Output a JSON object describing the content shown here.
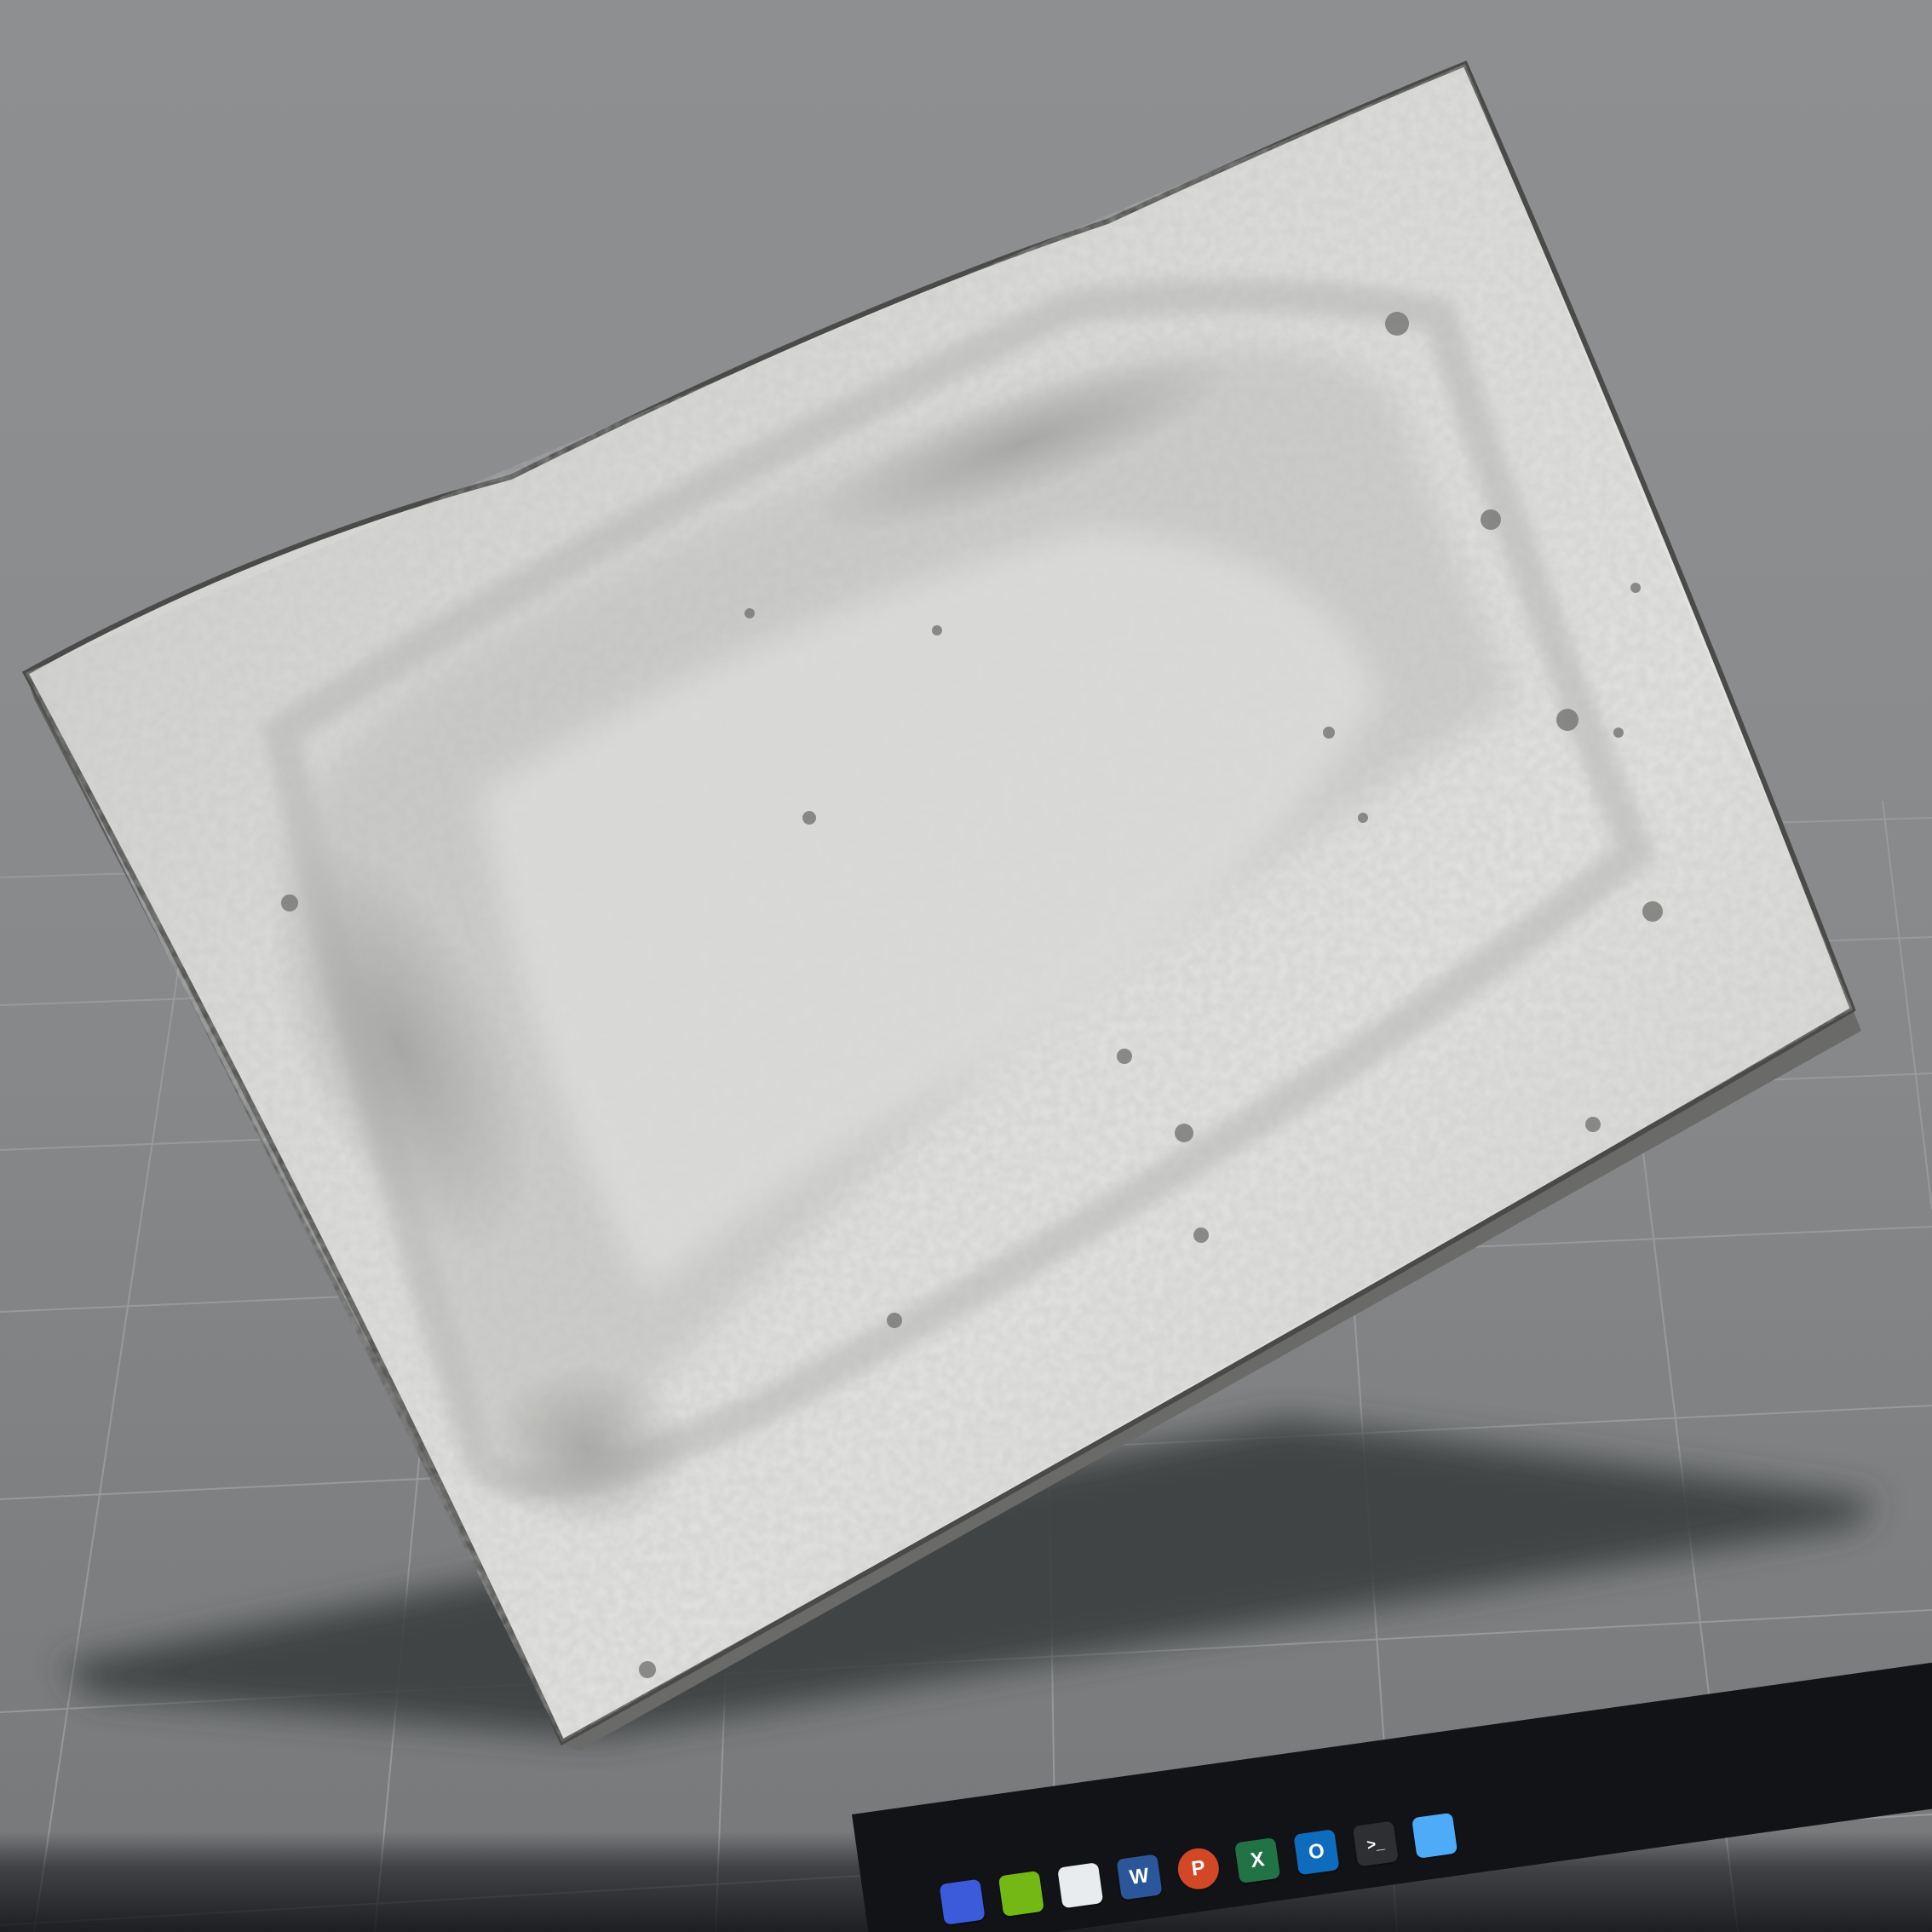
{
  "viewport": {
    "background_top": "#8d8f91",
    "background_bottom": "#76787a",
    "grid_color": "#9a9c9e",
    "mesh_color": "#d9d9d7",
    "shadow_color": "#3d3f41"
  },
  "taskbar": {
    "items": [
      {
        "name": "blue-app-icon",
        "glyph": "",
        "color": "#3b5bdb"
      },
      {
        "name": "green-app-icon",
        "glyph": "",
        "color": "#74b816"
      },
      {
        "name": "file-icon",
        "glyph": "",
        "color": "#e9ecef"
      },
      {
        "name": "word-icon",
        "glyph": "W",
        "color": "#2b579a"
      },
      {
        "name": "powerpoint-icon",
        "glyph": "P",
        "color": "#d24726"
      },
      {
        "name": "excel-icon",
        "glyph": "X",
        "color": "#217346"
      },
      {
        "name": "outlook-icon",
        "glyph": "O",
        "color": "#0f6cbd"
      },
      {
        "name": "terminal-icon",
        "glyph": ">_",
        "color": "#2d2f33"
      },
      {
        "name": "notes-icon",
        "glyph": "",
        "color": "#4dabf7"
      }
    ]
  }
}
